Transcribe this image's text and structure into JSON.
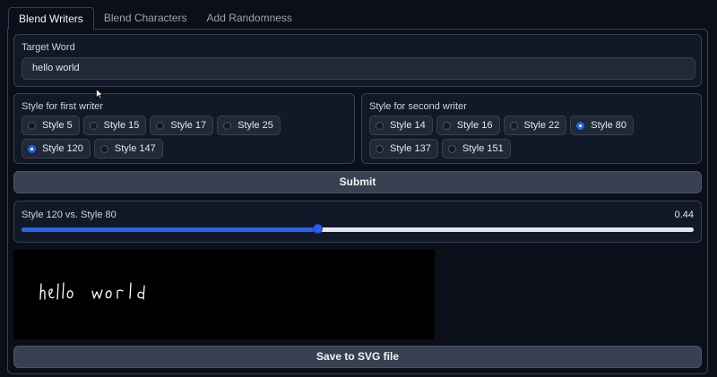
{
  "tabs": [
    {
      "label": "Blend Writers",
      "active": true
    },
    {
      "label": "Blend Characters",
      "active": false
    },
    {
      "label": "Add Randomness",
      "active": false
    }
  ],
  "target_word": {
    "label": "Target Word",
    "value": "hello world"
  },
  "first_writer": {
    "label": "Style for first writer",
    "options": [
      "Style 5",
      "Style 15",
      "Style 17",
      "Style 25",
      "Style 120",
      "Style 147"
    ],
    "selected": "Style 120"
  },
  "second_writer": {
    "label": "Style for second writer",
    "options": [
      "Style 14",
      "Style 16",
      "Style 22",
      "Style 80",
      "Style 137",
      "Style 151"
    ],
    "selected": "Style 80"
  },
  "submit_label": "Submit",
  "slider": {
    "label": "Style 120 vs. Style 80",
    "value": "0.44",
    "fraction": 0.44
  },
  "output_image": {
    "handwriting_text": "hello world",
    "ink_color": "#ffffff",
    "background": "#000000"
  },
  "save_label": "Save to SVG file",
  "colors": {
    "accent": "#2563eb",
    "background": "#0b0f19",
    "panel": "#111827",
    "button": "#374151"
  }
}
